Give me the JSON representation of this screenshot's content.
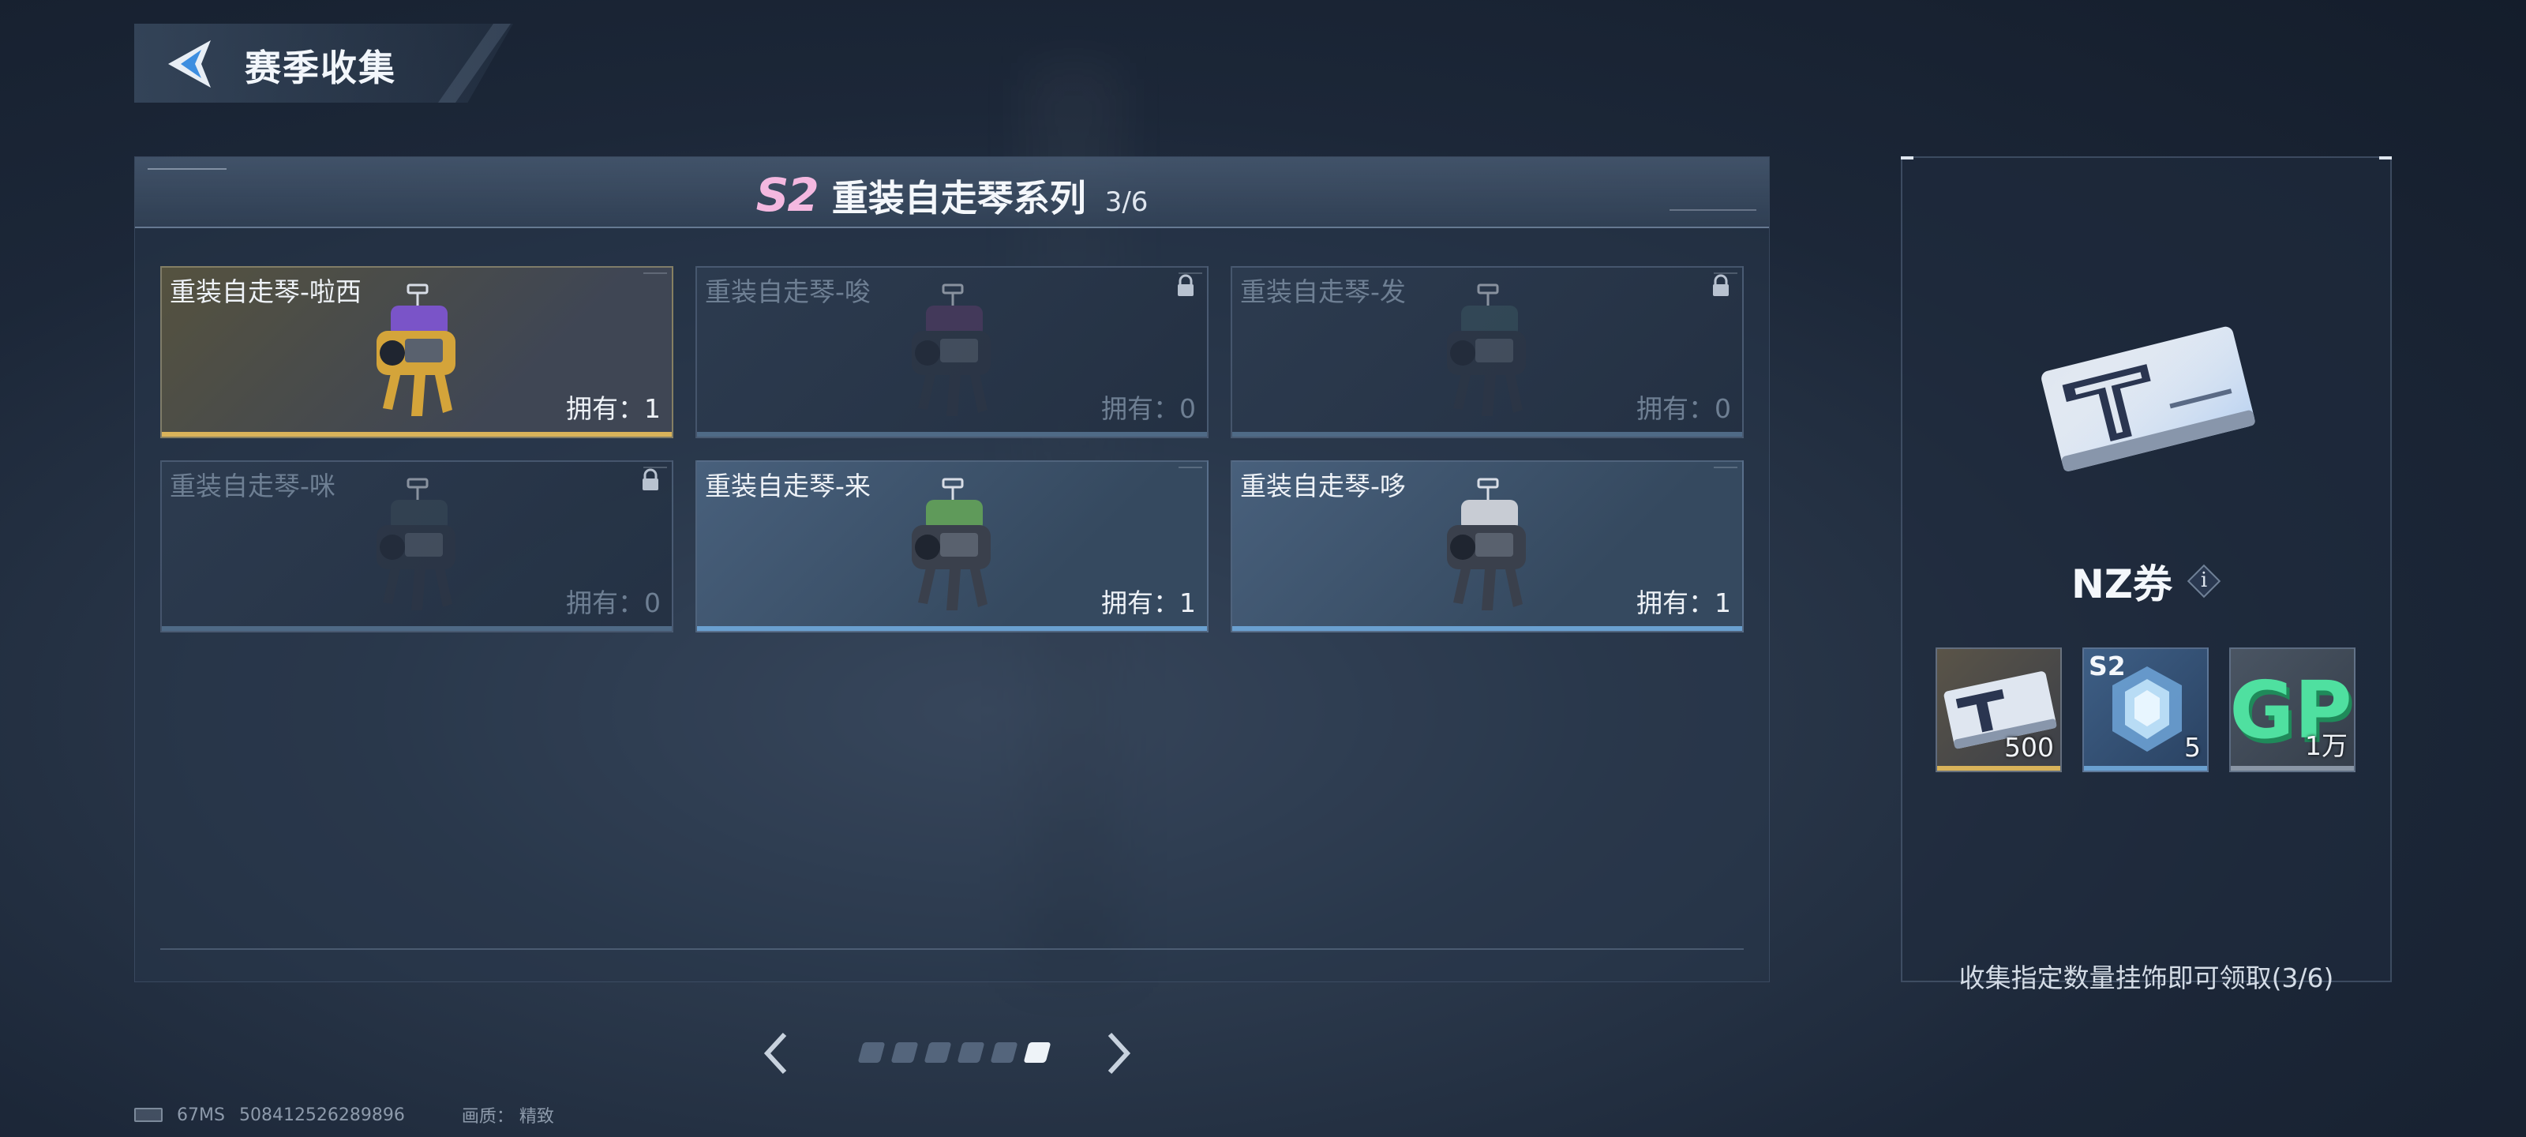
{
  "header": {
    "title": "赛季收集",
    "back_icon": "back-arrow-icon"
  },
  "series": {
    "badge": "S2",
    "title": "重装自走琴系列",
    "progress": "3/6"
  },
  "cards": [
    {
      "name": "重装自走琴-啦西",
      "owned_label": "拥有：1",
      "owned": 1,
      "state": "gold",
      "locked": false,
      "accent": "#d9b35a",
      "robot_color": "#d4a43a",
      "robot_top": "#7a54c8"
    },
    {
      "name": "重装自走琴-唆",
      "owned_label": "拥有：0",
      "owned": 0,
      "state": "locked",
      "locked": true,
      "accent": "#4f6a86",
      "robot_color": "#2f3645",
      "robot_top": "#5a3c68"
    },
    {
      "name": "重装自走琴-发",
      "owned_label": "拥有：0",
      "owned": 0,
      "state": "locked",
      "locked": true,
      "accent": "#4f6a86",
      "robot_color": "#2f3645",
      "robot_top": "#3a5560"
    },
    {
      "name": "重装自走琴-咪",
      "owned_label": "拥有：0",
      "owned": 0,
      "state": "locked",
      "locked": true,
      "accent": "#4f6a86",
      "robot_color": "#2f3645",
      "robot_top": "#3a4a58"
    },
    {
      "name": "重装自走琴-来",
      "owned_label": "拥有：1",
      "owned": 1,
      "state": "blue",
      "locked": false,
      "accent": "#6aa0d0",
      "robot_color": "#3a404c",
      "robot_top": "#5f9a5a"
    },
    {
      "name": "重装自走琴-哆",
      "owned_label": "拥有：1",
      "owned": 1,
      "state": "blue",
      "locked": false,
      "accent": "#6aa0d0",
      "robot_color": "#3a404c",
      "robot_top": "#c8ccd4"
    }
  ],
  "pagination": {
    "total": 6,
    "current": 6,
    "prev_icon": "chevron-left-icon",
    "next_icon": "chevron-right-icon"
  },
  "reward": {
    "name": "NZ券",
    "info_label": "i",
    "items": [
      {
        "icon": "nz-ticket-icon",
        "count": "500",
        "tag": ""
      },
      {
        "icon": "s2-crystal-icon",
        "count": "5",
        "tag": "S2"
      },
      {
        "icon": "gp-coin-icon",
        "count": "1万",
        "tag": ""
      }
    ],
    "description": "收集指定数量挂饰即可领取(3/6)"
  },
  "status": {
    "ping": "67MS",
    "uid": "508412526289896",
    "quality": "画质： 精致"
  },
  "colors": {
    "accent_gold": "#d9b35a",
    "accent_blue": "#6aa0d0",
    "season_pink": "#f4b8e0"
  }
}
